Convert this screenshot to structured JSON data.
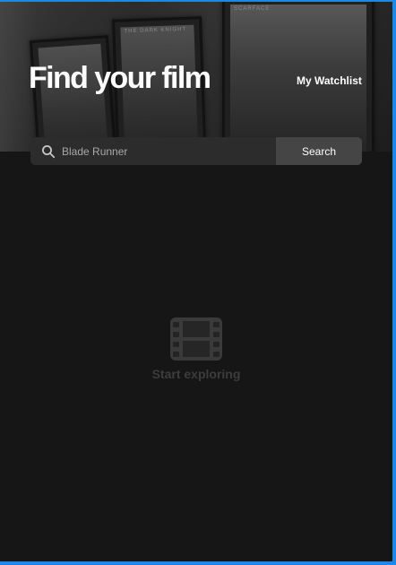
{
  "header": {
    "title": "Find your film",
    "watchlist_link": "My Watchlist"
  },
  "hero": {
    "poster_captions": [
      "THE DARK KNIGHT",
      "SCARFACE"
    ]
  },
  "search": {
    "value": "Blade Runner",
    "placeholder": "Blade Runner",
    "button_label": "Search",
    "icon": "search-icon"
  },
  "empty_state": {
    "icon": "film-icon",
    "label": "Start exploring"
  },
  "colors": {
    "background": "#161616",
    "frame_border": "#1e88e5",
    "search_field": "#2c2c2c",
    "search_button": "#454545",
    "muted": "#3c3c3c"
  }
}
